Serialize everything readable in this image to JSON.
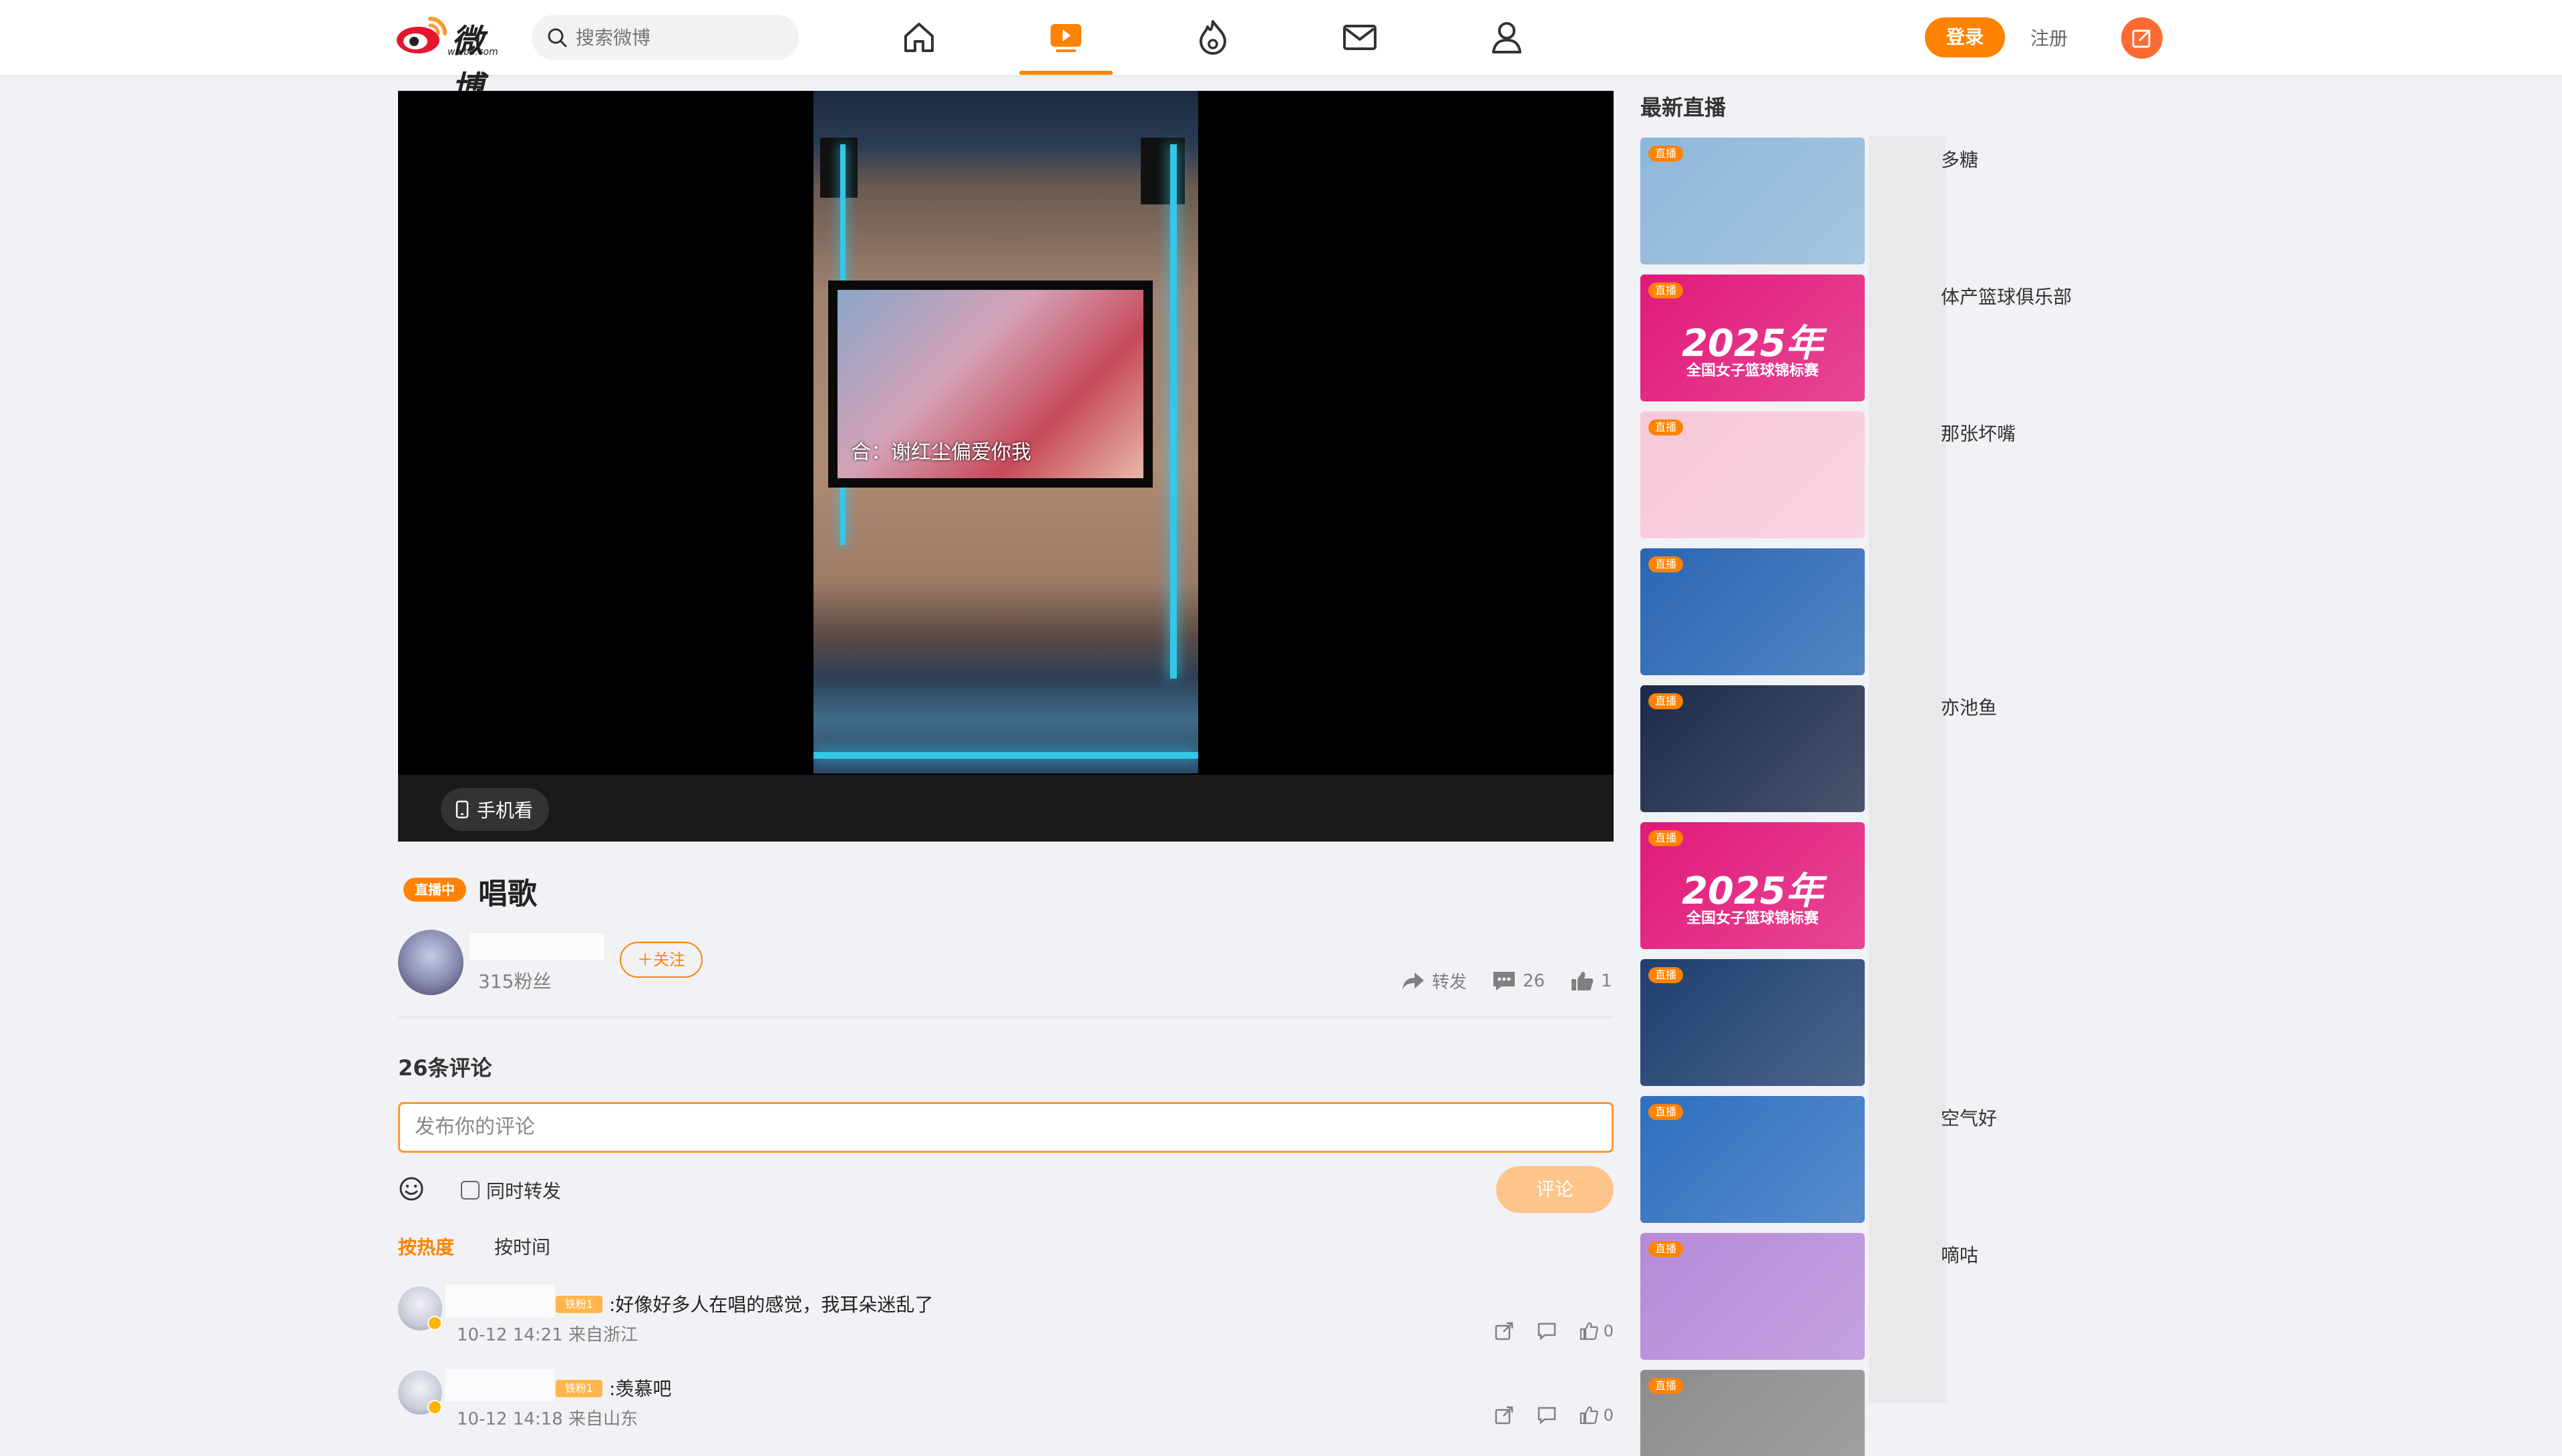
{
  "header": {
    "logo_text": "微博",
    "logo_sub": "weibo.com",
    "search_placeholder": "搜索微博",
    "login_label": "登录",
    "register_label": "注册"
  },
  "player": {
    "mobile_watch_label": "手机看",
    "tv_caption": "合：谢红尘偏爱你我"
  },
  "live": {
    "badge": "直播中",
    "title": "唱歌",
    "fans": "315粉丝",
    "follow_label": "＋关注",
    "repost_label": "转发",
    "comment_count": "26",
    "like_count": "1"
  },
  "comments": {
    "header": "26条评论",
    "input_placeholder": "发布你的评论",
    "repost_checkbox_label": "同时转发",
    "submit_label": "评论",
    "sort_hot": "按热度",
    "sort_time": "按时间",
    "items": [
      {
        "badge": "铁粉1",
        "text": ":好像好多人在唱的感觉，我耳朵迷乱了",
        "meta": "10-12 14:21 来自浙江",
        "likes": "0"
      },
      {
        "badge": "铁粉1",
        "text": ":羡慕吧",
        "meta": "10-12 14:18 来自山东",
        "likes": "0"
      }
    ]
  },
  "sidebar": {
    "title": "最新直播",
    "tag": "直播",
    "cards": [
      {
        "label": "多糖",
        "color": "#8fb7d9",
        "big": "",
        "sub": ""
      },
      {
        "label": "体产篮球俱乐部",
        "color": "#e1197a",
        "big": "2025年",
        "sub": "全国女子篮球锦标赛"
      },
      {
        "label": "那张坏嘴",
        "color": "#f7c8d8",
        "big": "",
        "sub": ""
      },
      {
        "label": "",
        "color": "#2a66b3",
        "big": "",
        "sub": ""
      },
      {
        "label": "亦池鱼",
        "color": "#1c2a4a",
        "big": "",
        "sub": ""
      },
      {
        "label": "",
        "color": "#e1197a",
        "big": "2025年",
        "sub": "全国女子篮球锦标赛"
      },
      {
        "label": "",
        "color": "#1f3f6f",
        "big": "",
        "sub": ""
      },
      {
        "label": "空气好",
        "color": "#2f6fbf",
        "big": "",
        "sub": ""
      },
      {
        "label": "嘀咕",
        "color": "#b68ad8",
        "big": "",
        "sub": ""
      },
      {
        "label": "",
        "color": "#8c8c8c",
        "big": "",
        "sub": ""
      }
    ]
  }
}
